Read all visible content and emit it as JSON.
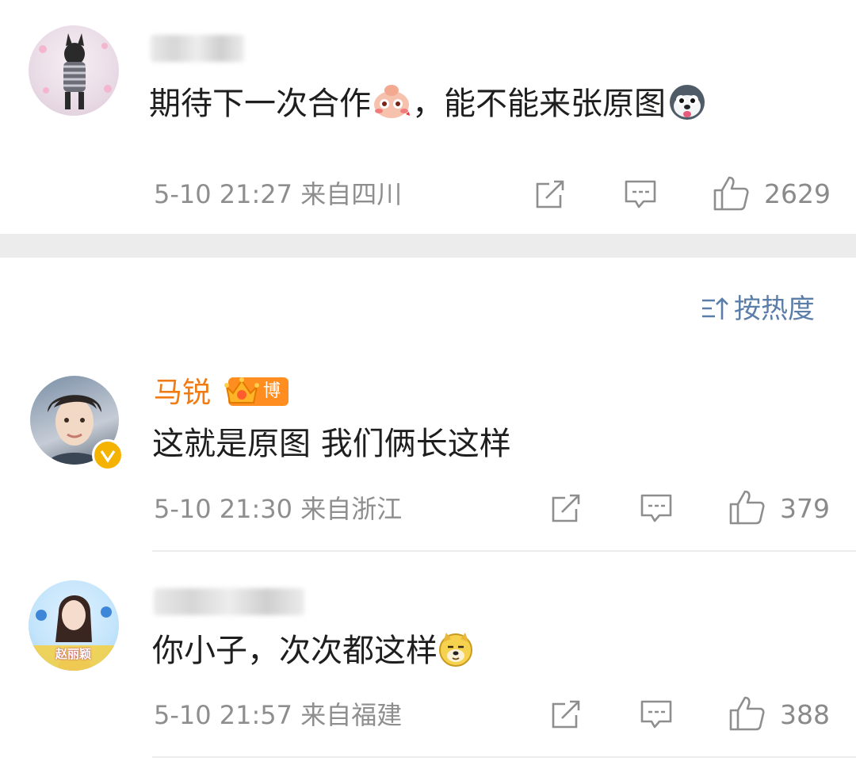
{
  "comments": [
    {
      "text": "期待下一次合作",
      "text_tail": "，能不能来张原图",
      "time": "5-10 21:27",
      "location": "来自四川",
      "likes": "2629",
      "emojis": [
        "shy-face-emoji",
        "husky-face-emoji"
      ]
    },
    {
      "username": "马锐",
      "badge": "博主",
      "text": "这就是原图 我们俩长这样",
      "time": "5-10 21:30",
      "location": "来自浙江",
      "likes": "379"
    },
    {
      "text": "你小子，次次都这样",
      "time": "5-10 21:57",
      "location": "来自福建",
      "likes": "388",
      "emojis": [
        "doge-emoji"
      ],
      "avatar_caption": "赵丽颖"
    }
  ],
  "sort_label": "按热度",
  "colors": {
    "blogger_name": "#f07b12",
    "sort_link": "#5a7ea9",
    "meta_text": "#8e8e8e",
    "divider": "#ececec"
  }
}
